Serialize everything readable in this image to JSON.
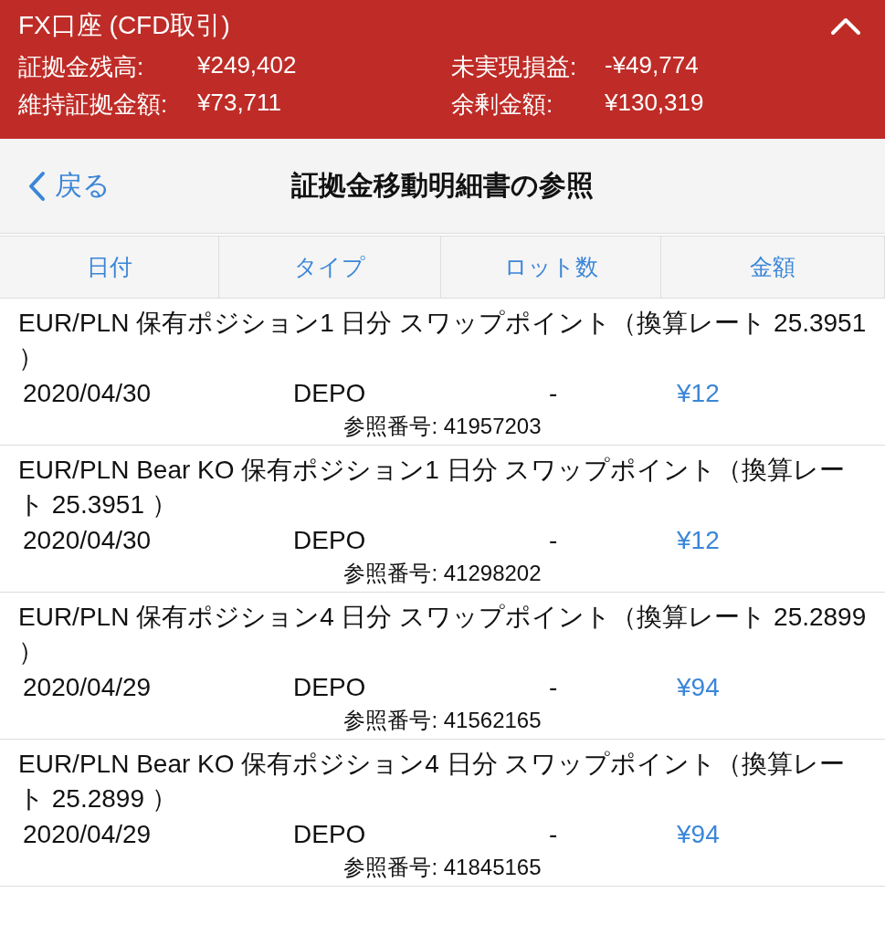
{
  "account": {
    "title": "FX口座 (CFD取引)",
    "stats": [
      {
        "label": "証拠金残高:",
        "value": "¥249,402"
      },
      {
        "label": "未実現損益:",
        "value": "-¥49,774"
      },
      {
        "label": "維持証拠金額:",
        "value": "¥73,711"
      },
      {
        "label": "余剰金額:",
        "value": "¥130,319"
      }
    ]
  },
  "nav": {
    "back": "戻る",
    "title": "証拠金移動明細書の参照"
  },
  "columns": [
    "日付",
    "タイプ",
    "ロット数",
    "金額"
  ],
  "entries": [
    {
      "description": "EUR/PLN 保有ポジション1 日分 スワップポイント（換算レート 25.3951 ）",
      "date": "2020/04/30",
      "type": "DEPO",
      "lots": "-",
      "amount": "¥12",
      "reference": "参照番号: 41957203"
    },
    {
      "description": "EUR/PLN Bear KO 保有ポジション1 日分 スワップポイント（換算レート 25.3951 ）",
      "date": "2020/04/30",
      "type": "DEPO",
      "lots": "-",
      "amount": "¥12",
      "reference": "参照番号: 41298202"
    },
    {
      "description": "EUR/PLN 保有ポジション4 日分 スワップポイント（換算レート 25.2899 ）",
      "date": "2020/04/29",
      "type": "DEPO",
      "lots": "-",
      "amount": "¥94",
      "reference": "参照番号: 41562165"
    },
    {
      "description": "EUR/PLN Bear KO 保有ポジション4 日分 スワップポイント（換算レート 25.2899 ）",
      "date": "2020/04/29",
      "type": "DEPO",
      "lots": "-",
      "amount": "¥94",
      "reference": "参照番号: 41845165"
    }
  ]
}
